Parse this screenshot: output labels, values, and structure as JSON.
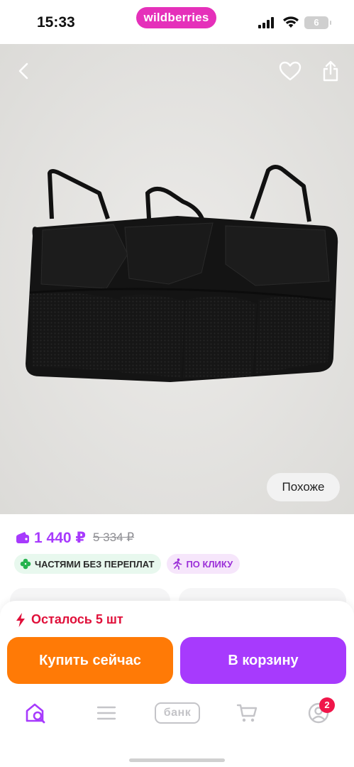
{
  "status_bar": {
    "time": "15:33",
    "brand": "wildberries",
    "battery": "6",
    "icons": [
      "signal-icon",
      "wifi-icon",
      "battery-icon"
    ]
  },
  "photo": {
    "subject": "black car seat back organizer with mesh pockets",
    "similar_label": "Похоже",
    "icons": [
      "back-arrow-icon",
      "heart-icon",
      "share-icon"
    ]
  },
  "product": {
    "price": "1 440 ₽",
    "old_price": "5 334 ₽",
    "badges": [
      {
        "label": "ЧАСТЯМИ БЕЗ ПЕРЕПЛАТ",
        "icon": "clover-icon",
        "color": "#27b34f"
      },
      {
        "label": "ПО КЛИКУ",
        "icon": "running-person-icon",
        "color": "#9b2fd8"
      }
    ]
  },
  "sheet": {
    "stock_text": "Осталось 5 шт",
    "buy_now_label": "Купить сейчас",
    "add_to_cart_label": "В корзину"
  },
  "tabbar": {
    "items": [
      {
        "name": "home",
        "icon": "home-search-icon",
        "active": true
      },
      {
        "name": "catalog",
        "icon": "menu-icon"
      },
      {
        "name": "bank",
        "icon": "bank-icon",
        "label": "банк"
      },
      {
        "name": "cart",
        "icon": "cart-icon"
      },
      {
        "name": "profile",
        "icon": "profile-icon",
        "badge": "2"
      }
    ]
  },
  "colors": {
    "accent_purple": "#a73afd",
    "orange": "#ff7a06",
    "brand_pink": "#e530ba",
    "alert_red": "#e0103a"
  }
}
